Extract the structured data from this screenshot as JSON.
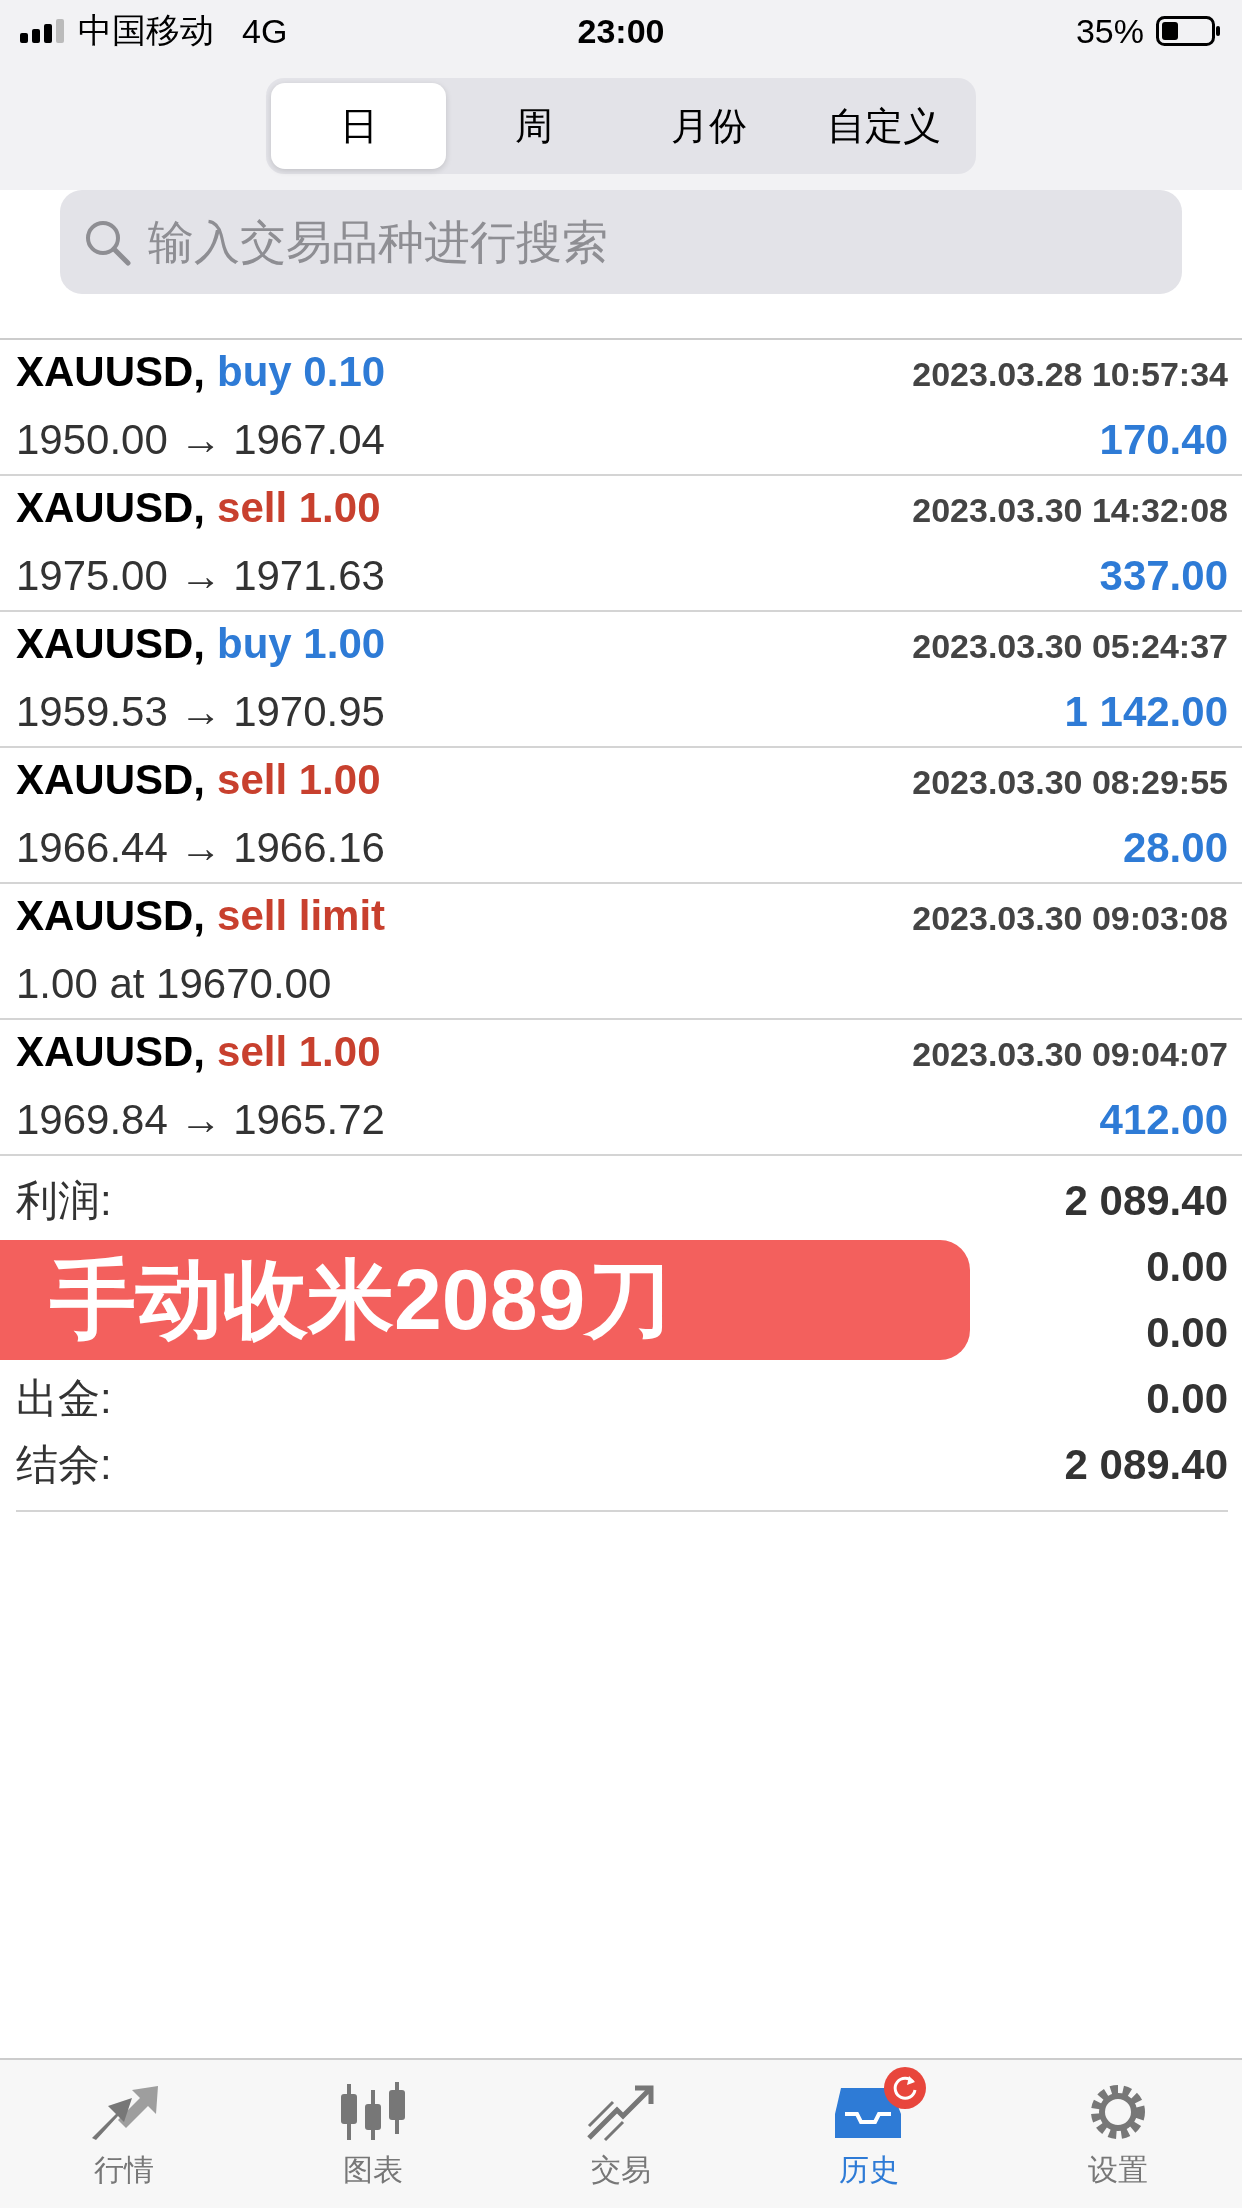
{
  "status_bar": {
    "carrier": "中国移动",
    "network": "4G",
    "time": "23:00",
    "battery": "35%"
  },
  "periods": [
    {
      "label": "日",
      "selected": true
    },
    {
      "label": "周",
      "selected": false
    },
    {
      "label": "月份",
      "selected": false
    },
    {
      "label": "自定义",
      "selected": false
    }
  ],
  "search": {
    "placeholder": "输入交易品种进行搜索"
  },
  "trades": [
    {
      "symbol": "XAUUSD,",
      "kind": "buy",
      "action": "buy 0.10",
      "time": "2023.03.28 10:57:34",
      "prices": "1950.00 → 1967.04",
      "profit": "170.40"
    },
    {
      "symbol": "XAUUSD,",
      "kind": "sell",
      "action": "sell 1.00",
      "time": "2023.03.30 14:32:08",
      "prices": "1975.00 → 1971.63",
      "profit": "337.00"
    },
    {
      "symbol": "XAUUSD,",
      "kind": "buy",
      "action": "buy 1.00",
      "time": "2023.03.30 05:24:37",
      "prices": "1959.53 → 1970.95",
      "profit": "1 142.00"
    },
    {
      "symbol": "XAUUSD,",
      "kind": "sell",
      "action": "sell 1.00",
      "time": "2023.03.30 08:29:55",
      "prices": "1966.44 → 1966.16",
      "profit": "28.00"
    },
    {
      "symbol": "XAUUSD,",
      "kind": "sell",
      "action": "sell limit",
      "time": "2023.03.30 09:03:08",
      "prices": "1.00 at 19670.00"
    },
    {
      "symbol": "XAUUSD,",
      "kind": "sell",
      "action": "sell 1.00",
      "time": "2023.03.30 09:04:07",
      "prices": "1969.84 → 1965.72",
      "profit": "412.00"
    }
  ],
  "summary": [
    {
      "label": "利润:",
      "value": "2 089.40"
    },
    {
      "value": "0.00"
    },
    {
      "value": "0.00"
    },
    {
      "label": "出金:",
      "value": "0.00"
    },
    {
      "label": "结余:",
      "value": "2 089.40"
    }
  ],
  "banner": {
    "text": "手动收米2089刀"
  },
  "tab_bar": [
    {
      "kind": "quotes",
      "label": "行情",
      "selected": false,
      "badge": false
    },
    {
      "kind": "chart",
      "label": "图表",
      "selected": false,
      "badge": false
    },
    {
      "kind": "trade",
      "label": "交易",
      "selected": false,
      "badge": false
    },
    {
      "kind": "history",
      "label": "历史",
      "selected": true,
      "badge": true
    },
    {
      "kind": "settings",
      "label": "设置",
      "selected": false,
      "badge": false
    }
  ]
}
